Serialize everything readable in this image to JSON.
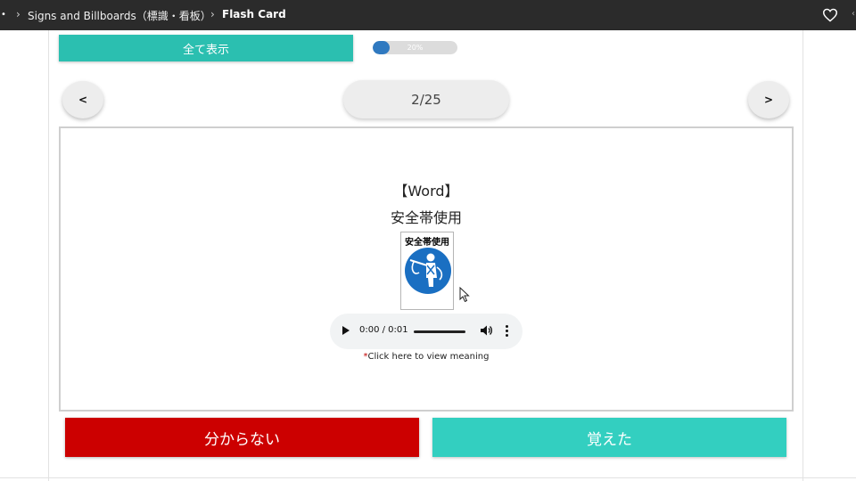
{
  "header": {
    "breadcrumbs": [
      "Signs and Billboards（標識・看板）",
      "Flash Card"
    ],
    "favorite_icon": "heart-icon"
  },
  "controls": {
    "show_all_label": "全て表示",
    "progress_percent": 20,
    "progress_label": "20%",
    "prev_label": "<",
    "next_label": ">",
    "counter": "2/25"
  },
  "card": {
    "word_label": "【Word】",
    "word": "安全帯使用",
    "sign_title": "安全帯使用",
    "sign_icon": "safety-harness-icon",
    "audio": {
      "time": "0:00 / 0:01"
    },
    "meaning_star": "*",
    "meaning_link": "Click here to view meaning"
  },
  "answers": {
    "dont_know_label": "分からない",
    "memorized_label": "覚えた"
  },
  "colors": {
    "top_bar": "#2b2b2b",
    "show_all": "#2bbfb0",
    "progress": "#2f79c0",
    "dont_know": "#cc0000",
    "memorized": "#33cfc0",
    "sign_blue": "#1a6fc2"
  }
}
